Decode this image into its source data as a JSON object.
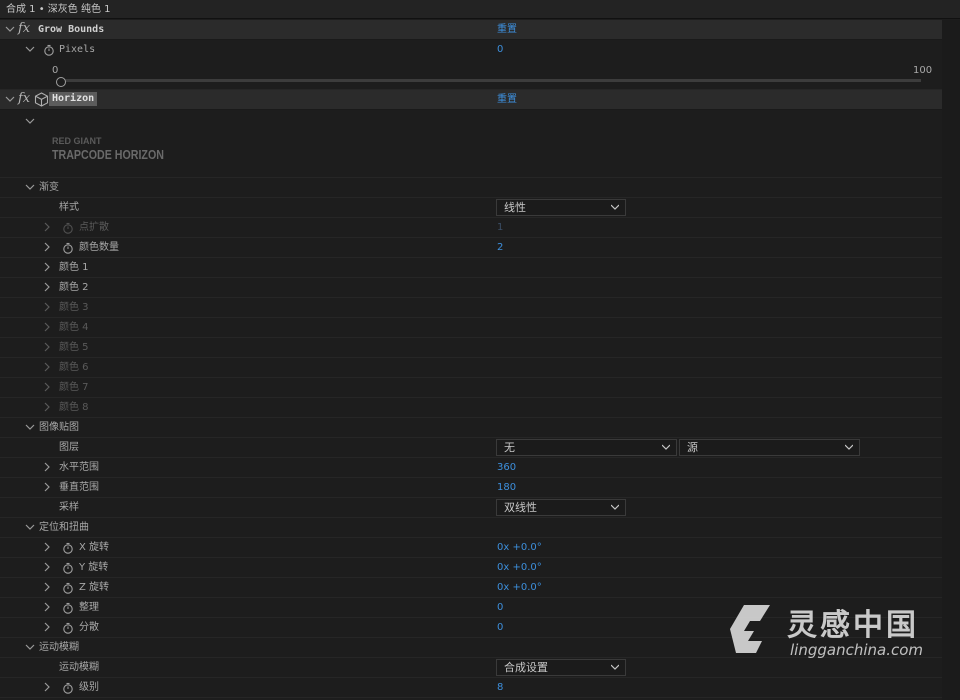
{
  "header": {
    "title": "合成 1 • 深灰色 纯色 1"
  },
  "grow_bounds": {
    "name": "Grow Bounds",
    "reset": "重置",
    "pixels_label": "Pixels",
    "pixels_value": "0",
    "slider_min": "0",
    "slider_max": "100",
    "slider_value": 0
  },
  "horizon": {
    "name": "Horizon",
    "reset": "重置",
    "logo_line1": "RED GIANT",
    "logo_line2": "TRAPCODE HORIZON"
  },
  "gradient": {
    "label": "渐变",
    "style_label": "样式",
    "style_value": "线性",
    "spread_label": "点扩散",
    "spread_value": "1",
    "color_count_label": "颜色数量",
    "color_count_value": "2",
    "colors": [
      "颜色 1",
      "颜色 2",
      "颜色 3",
      "颜色 4",
      "颜色 5",
      "颜色 6",
      "颜色 7",
      "颜色 8"
    ]
  },
  "image_map": {
    "label": "图像贴图",
    "layer_label": "图层",
    "layer_value": "无",
    "source_value": "源",
    "hrange_label": "水平范围",
    "hrange_value": "360",
    "vrange_label": "垂直范围",
    "vrange_value": "180",
    "sampling_label": "采样",
    "sampling_value": "双线性"
  },
  "position_distort": {
    "label": "定位和扭曲",
    "x_label": "X 旋转",
    "x_value": "0x +0.0°",
    "y_label": "Y 旋转",
    "y_value": "0x +0.0°",
    "z_label": "Z 旋转",
    "z_value": "0x +0.0°",
    "twist_label": "整理",
    "twist_value": "0",
    "scatter_label": "分散",
    "scatter_value": "0"
  },
  "motion_blur": {
    "label": "运动模糊",
    "mode_label": "运动模糊",
    "mode_value": "合成设置",
    "level_label": "级别",
    "level_value": "8"
  },
  "watermark": {
    "title": "灵感中国",
    "subtitle": "lingganchina.com"
  }
}
